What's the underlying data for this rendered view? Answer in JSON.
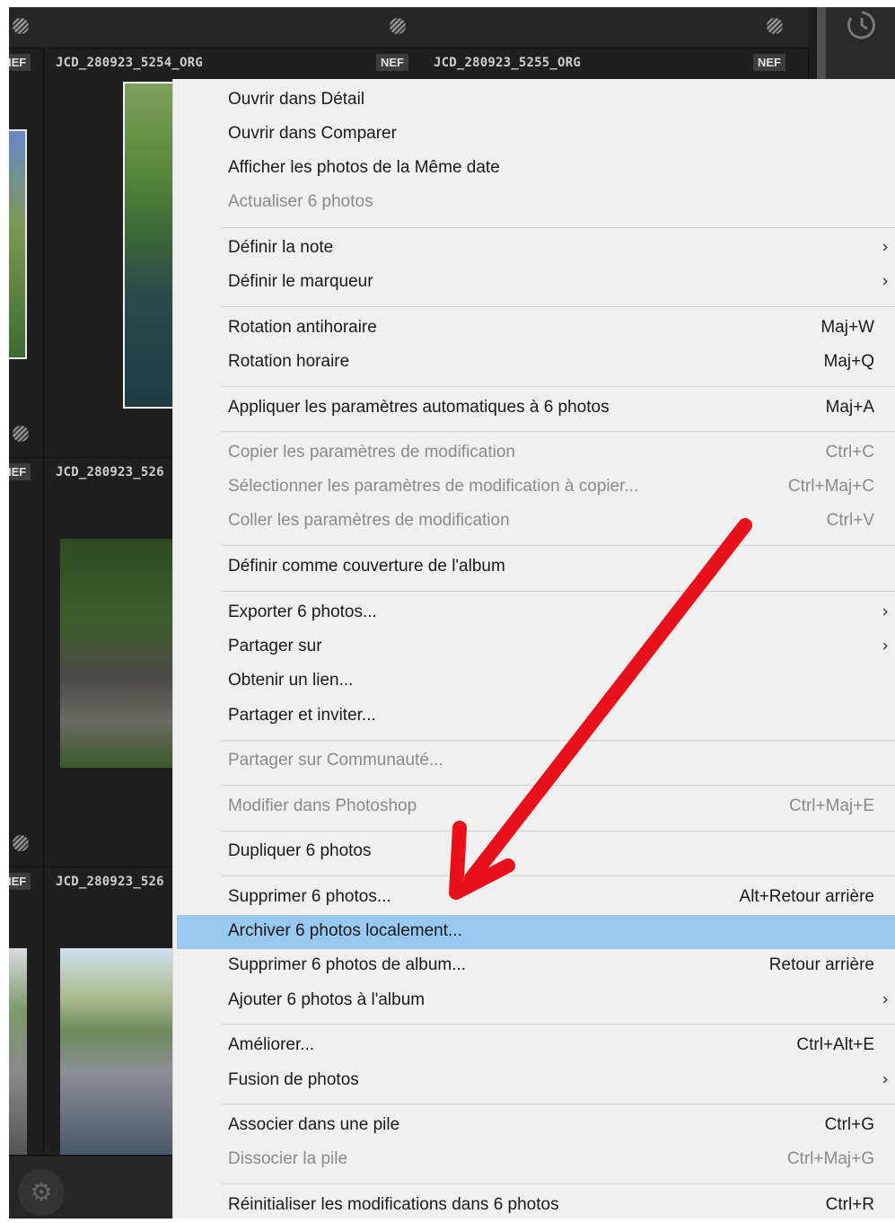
{
  "grid": {
    "cells": [
      {
        "name": "JCD_280923_5254_ORG",
        "badge": "NEF"
      },
      {
        "name": "JCD_280923_5255_ORG",
        "badge": "NEF"
      },
      {
        "name": "JCD_280923_526",
        "badge": ""
      },
      {
        "name": "JCD_280923_526",
        "badge": ""
      }
    ],
    "left_badges": [
      "IEF",
      "IEF",
      "IEF"
    ]
  },
  "context_menu": {
    "items": [
      {
        "label": "Ouvrir dans Détail",
        "shortcut": "",
        "submenu": false,
        "disabled": false,
        "highlighted": false
      },
      {
        "label": "Ouvrir dans Comparer",
        "shortcut": "",
        "submenu": false,
        "disabled": false,
        "highlighted": false
      },
      {
        "label": "Afficher les photos de la Même date",
        "shortcut": "",
        "submenu": false,
        "disabled": false,
        "highlighted": false
      },
      {
        "label": "Actualiser 6 photos",
        "shortcut": "",
        "submenu": false,
        "disabled": true,
        "highlighted": false
      },
      {
        "label": "Définir la note",
        "shortcut": "",
        "submenu": true,
        "disabled": false,
        "highlighted": false
      },
      {
        "label": "Définir le marqueur",
        "shortcut": "",
        "submenu": true,
        "disabled": false,
        "highlighted": false
      },
      {
        "label": "Rotation antihoraire",
        "shortcut": "Maj+W",
        "submenu": false,
        "disabled": false,
        "highlighted": false
      },
      {
        "label": "Rotation horaire",
        "shortcut": "Maj+Q",
        "submenu": false,
        "disabled": false,
        "highlighted": false
      },
      {
        "label": "Appliquer les paramètres automatiques à 6 photos",
        "shortcut": "Maj+A",
        "submenu": false,
        "disabled": false,
        "highlighted": false
      },
      {
        "label": "Copier les paramètres de modification",
        "shortcut": "Ctrl+C",
        "submenu": false,
        "disabled": true,
        "highlighted": false
      },
      {
        "label": "Sélectionner les paramètres de modification à copier...",
        "shortcut": "Ctrl+Maj+C",
        "submenu": false,
        "disabled": true,
        "highlighted": false
      },
      {
        "label": "Coller les paramètres de modification",
        "shortcut": "Ctrl+V",
        "submenu": false,
        "disabled": true,
        "highlighted": false
      },
      {
        "label": "Définir comme couverture de l'album",
        "shortcut": "",
        "submenu": false,
        "disabled": false,
        "highlighted": false
      },
      {
        "label": "Exporter 6 photos...",
        "shortcut": "",
        "submenu": true,
        "disabled": false,
        "highlighted": false
      },
      {
        "label": "Partager sur",
        "shortcut": "",
        "submenu": true,
        "disabled": false,
        "highlighted": false
      },
      {
        "label": "Obtenir un lien...",
        "shortcut": "",
        "submenu": false,
        "disabled": false,
        "highlighted": false
      },
      {
        "label": "Partager et inviter...",
        "shortcut": "",
        "submenu": false,
        "disabled": false,
        "highlighted": false
      },
      {
        "label": "Partager sur Communauté...",
        "shortcut": "",
        "submenu": false,
        "disabled": true,
        "highlighted": false
      },
      {
        "label": "Modifier dans Photoshop",
        "shortcut": "Ctrl+Maj+E",
        "submenu": false,
        "disabled": true,
        "highlighted": false
      },
      {
        "label": "Dupliquer 6 photos",
        "shortcut": "",
        "submenu": false,
        "disabled": false,
        "highlighted": false
      },
      {
        "label": "Supprimer 6 photos...",
        "shortcut": "Alt+Retour arrière",
        "submenu": false,
        "disabled": false,
        "highlighted": false
      },
      {
        "label": "Archiver 6 photos localement...",
        "shortcut": "",
        "submenu": false,
        "disabled": false,
        "highlighted": true
      },
      {
        "label": "Supprimer 6 photos de album...",
        "shortcut": "Retour arrière",
        "submenu": false,
        "disabled": false,
        "highlighted": false
      },
      {
        "label": "Ajouter 6 photos à l'album",
        "shortcut": "",
        "submenu": true,
        "disabled": false,
        "highlighted": false
      },
      {
        "label": "Améliorer...",
        "shortcut": "Ctrl+Alt+E",
        "submenu": false,
        "disabled": false,
        "highlighted": false
      },
      {
        "label": "Fusion de photos",
        "shortcut": "",
        "submenu": true,
        "disabled": false,
        "highlighted": false
      },
      {
        "label": "Associer dans une pile",
        "shortcut": "Ctrl+G",
        "submenu": false,
        "disabled": false,
        "highlighted": false
      },
      {
        "label": "Dissocier la pile",
        "shortcut": "Ctrl+Maj+G",
        "submenu": false,
        "disabled": true,
        "highlighted": false
      },
      {
        "label": "Réinitialiser les modifications dans 6 photos",
        "shortcut": "Ctrl+R",
        "submenu": false,
        "disabled": false,
        "highlighted": false
      }
    ],
    "chevron_glyph": "›",
    "highlight_color": "#99c8f0",
    "annotation_arrow_color": "#e8101a"
  }
}
